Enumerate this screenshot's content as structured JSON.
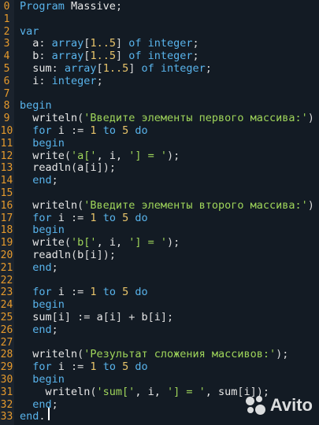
{
  "editor": {
    "theme": {
      "background": "#131b24",
      "gutter": "#1b232d",
      "line_number": "#e69a2c",
      "keyword": "#59b4ec",
      "string": "#9fd55a",
      "number": "#e8c46a",
      "text": "#e8e8e8"
    },
    "lines": [
      {
        "num": "0",
        "segs": [
          {
            "t": "Program",
            "c": "kw"
          },
          {
            "t": " Massive",
            "c": "id"
          },
          {
            "t": ";",
            "c": "pu"
          }
        ]
      },
      {
        "num": "1",
        "segs": []
      },
      {
        "num": "2",
        "segs": [
          {
            "t": "var",
            "c": "kw"
          }
        ]
      },
      {
        "num": "3",
        "segs": [
          {
            "t": "  a",
            "c": "id"
          },
          {
            "t": ": ",
            "c": "pu"
          },
          {
            "t": "array",
            "c": "ty"
          },
          {
            "t": "[",
            "c": "pu"
          },
          {
            "t": "1..5",
            "c": "num"
          },
          {
            "t": "]",
            "c": "pu"
          },
          {
            "t": " of ",
            "c": "kw"
          },
          {
            "t": "integer",
            "c": "ty"
          },
          {
            "t": ";",
            "c": "pu"
          }
        ]
      },
      {
        "num": "4",
        "segs": [
          {
            "t": "  b",
            "c": "id"
          },
          {
            "t": ": ",
            "c": "pu"
          },
          {
            "t": "array",
            "c": "ty"
          },
          {
            "t": "[",
            "c": "pu"
          },
          {
            "t": "1..5",
            "c": "num"
          },
          {
            "t": "]",
            "c": "pu"
          },
          {
            "t": " of ",
            "c": "kw"
          },
          {
            "t": "integer",
            "c": "ty"
          },
          {
            "t": ";",
            "c": "pu"
          }
        ]
      },
      {
        "num": "5",
        "segs": [
          {
            "t": "  sum",
            "c": "id"
          },
          {
            "t": ": ",
            "c": "pu"
          },
          {
            "t": "array",
            "c": "ty"
          },
          {
            "t": "[",
            "c": "pu"
          },
          {
            "t": "1..5",
            "c": "num"
          },
          {
            "t": "]",
            "c": "pu"
          },
          {
            "t": " of ",
            "c": "kw"
          },
          {
            "t": "integer",
            "c": "ty"
          },
          {
            "t": ";",
            "c": "pu"
          }
        ]
      },
      {
        "num": "6",
        "segs": [
          {
            "t": "  i",
            "c": "id"
          },
          {
            "t": ": ",
            "c": "pu"
          },
          {
            "t": "integer",
            "c": "ty"
          },
          {
            "t": ";",
            "c": "pu"
          }
        ]
      },
      {
        "num": "7",
        "segs": []
      },
      {
        "num": "8",
        "segs": [
          {
            "t": "begin",
            "c": "kw"
          }
        ]
      },
      {
        "num": "9",
        "segs": [
          {
            "t": "  writeln",
            "c": "id"
          },
          {
            "t": "(",
            "c": "pu"
          },
          {
            "t": "'Введите элементы первого массива:'",
            "c": "str"
          },
          {
            "t": ")",
            "c": "pu"
          }
        ]
      },
      {
        "num": "10",
        "segs": [
          {
            "t": "  for",
            "c": "kw"
          },
          {
            "t": " i ",
            "c": "id"
          },
          {
            "t": ":= ",
            "c": "pu"
          },
          {
            "t": "1",
            "c": "num"
          },
          {
            "t": " to ",
            "c": "kw"
          },
          {
            "t": "5",
            "c": "num"
          },
          {
            "t": " do",
            "c": "kw"
          }
        ]
      },
      {
        "num": "11",
        "segs": [
          {
            "t": "  begin",
            "c": "kw"
          }
        ]
      },
      {
        "num": "12",
        "segs": [
          {
            "t": "  write",
            "c": "id"
          },
          {
            "t": "(",
            "c": "pu"
          },
          {
            "t": "'a['",
            "c": "str"
          },
          {
            "t": ", i, ",
            "c": "id"
          },
          {
            "t": "'] = '",
            "c": "str"
          },
          {
            "t": ");",
            "c": "pu"
          }
        ]
      },
      {
        "num": "13",
        "segs": [
          {
            "t": "  readln",
            "c": "id"
          },
          {
            "t": "(",
            "c": "pu"
          },
          {
            "t": "a",
            "c": "id"
          },
          {
            "t": "[",
            "c": "pu"
          },
          {
            "t": "i",
            "c": "id"
          },
          {
            "t": "]);",
            "c": "pu"
          }
        ]
      },
      {
        "num": "14",
        "segs": [
          {
            "t": "  end",
            "c": "kw"
          },
          {
            "t": ";",
            "c": "pu"
          }
        ]
      },
      {
        "num": "15",
        "segs": []
      },
      {
        "num": "16",
        "segs": [
          {
            "t": "  writeln",
            "c": "id"
          },
          {
            "t": "(",
            "c": "pu"
          },
          {
            "t": "'Введите элементы второго массива:'",
            "c": "str"
          },
          {
            "t": ")",
            "c": "pu"
          }
        ]
      },
      {
        "num": "17",
        "segs": [
          {
            "t": "  for",
            "c": "kw"
          },
          {
            "t": " i ",
            "c": "id"
          },
          {
            "t": ":= ",
            "c": "pu"
          },
          {
            "t": "1",
            "c": "num"
          },
          {
            "t": " to ",
            "c": "kw"
          },
          {
            "t": "5",
            "c": "num"
          },
          {
            "t": " do",
            "c": "kw"
          }
        ]
      },
      {
        "num": "18",
        "segs": [
          {
            "t": "  begin",
            "c": "kw"
          }
        ]
      },
      {
        "num": "19",
        "segs": [
          {
            "t": "  write",
            "c": "id"
          },
          {
            "t": "(",
            "c": "pu"
          },
          {
            "t": "'b['",
            "c": "str"
          },
          {
            "t": ", i, ",
            "c": "id"
          },
          {
            "t": "'] = '",
            "c": "str"
          },
          {
            "t": ");",
            "c": "pu"
          }
        ]
      },
      {
        "num": "20",
        "segs": [
          {
            "t": "  readln",
            "c": "id"
          },
          {
            "t": "(",
            "c": "pu"
          },
          {
            "t": "b",
            "c": "id"
          },
          {
            "t": "[",
            "c": "pu"
          },
          {
            "t": "i",
            "c": "id"
          },
          {
            "t": "]);",
            "c": "pu"
          }
        ]
      },
      {
        "num": "21",
        "segs": [
          {
            "t": "  end",
            "c": "kw"
          },
          {
            "t": ";",
            "c": "pu"
          }
        ]
      },
      {
        "num": "22",
        "segs": []
      },
      {
        "num": "23",
        "segs": [
          {
            "t": "  for",
            "c": "kw"
          },
          {
            "t": " i ",
            "c": "id"
          },
          {
            "t": ":= ",
            "c": "pu"
          },
          {
            "t": "1",
            "c": "num"
          },
          {
            "t": " to ",
            "c": "kw"
          },
          {
            "t": "5",
            "c": "num"
          },
          {
            "t": " do",
            "c": "kw"
          }
        ]
      },
      {
        "num": "24",
        "segs": [
          {
            "t": "  begin",
            "c": "kw"
          }
        ]
      },
      {
        "num": "25",
        "segs": [
          {
            "t": "  sum",
            "c": "id"
          },
          {
            "t": "[",
            "c": "pu"
          },
          {
            "t": "i",
            "c": "id"
          },
          {
            "t": "] := ",
            "c": "pu"
          },
          {
            "t": "a",
            "c": "id"
          },
          {
            "t": "[",
            "c": "pu"
          },
          {
            "t": "i",
            "c": "id"
          },
          {
            "t": "] + ",
            "c": "pu"
          },
          {
            "t": "b",
            "c": "id"
          },
          {
            "t": "[",
            "c": "pu"
          },
          {
            "t": "i",
            "c": "id"
          },
          {
            "t": "];",
            "c": "pu"
          }
        ]
      },
      {
        "num": "26",
        "segs": [
          {
            "t": "  end",
            "c": "kw"
          },
          {
            "t": ";",
            "c": "pu"
          }
        ]
      },
      {
        "num": "27",
        "segs": []
      },
      {
        "num": "28",
        "segs": [
          {
            "t": "  writeln",
            "c": "id"
          },
          {
            "t": "(",
            "c": "pu"
          },
          {
            "t": "'Результат сложения массивов:'",
            "c": "str"
          },
          {
            "t": ");",
            "c": "pu"
          }
        ]
      },
      {
        "num": "29",
        "segs": [
          {
            "t": "  for",
            "c": "kw"
          },
          {
            "t": " i ",
            "c": "id"
          },
          {
            "t": ":= ",
            "c": "pu"
          },
          {
            "t": "1",
            "c": "num"
          },
          {
            "t": " to ",
            "c": "kw"
          },
          {
            "t": "5",
            "c": "num"
          },
          {
            "t": " do",
            "c": "kw"
          }
        ]
      },
      {
        "num": "30",
        "segs": [
          {
            "t": "  begin",
            "c": "kw"
          }
        ]
      },
      {
        "num": "31",
        "segs": [
          {
            "t": "    writeln",
            "c": "id"
          },
          {
            "t": "(",
            "c": "pu"
          },
          {
            "t": "'sum['",
            "c": "str"
          },
          {
            "t": ", i, ",
            "c": "id"
          },
          {
            "t": "'] = '",
            "c": "str"
          },
          {
            "t": ", sum",
            "c": "id"
          },
          {
            "t": "[",
            "c": "pu"
          },
          {
            "t": "i",
            "c": "id"
          },
          {
            "t": "]);",
            "c": "pu"
          }
        ]
      },
      {
        "num": "32",
        "segs": [
          {
            "t": "  end",
            "c": "kw"
          },
          {
            "t": ";",
            "c": "pu"
          }
        ]
      },
      {
        "num": "33",
        "segs": [
          {
            "t": "end",
            "c": "kw"
          },
          {
            "t": ".",
            "c": "pu"
          }
        ]
      }
    ]
  },
  "watermark": {
    "text": "Avito",
    "icon": "avito-logo-icon"
  }
}
